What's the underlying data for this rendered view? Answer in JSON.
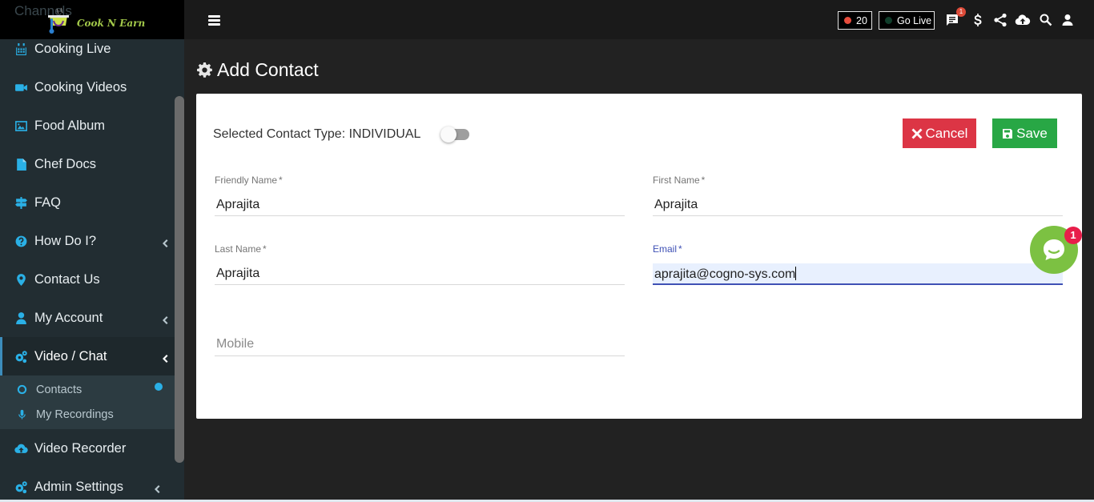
{
  "brand": {
    "ghost_label": "Channels",
    "name": "Cook N Earn"
  },
  "sidebar": {
    "items": [
      {
        "label": "Cooking Live"
      },
      {
        "label": "Cooking Videos"
      },
      {
        "label": "Food Album"
      },
      {
        "label": "Chef Docs"
      },
      {
        "label": "FAQ"
      },
      {
        "label": "How Do I?"
      },
      {
        "label": "Contact Us"
      },
      {
        "label": "My Account"
      },
      {
        "label": "Video / Chat"
      },
      {
        "label": "Video Recorder"
      },
      {
        "label": "Admin Settings"
      }
    ],
    "submenu": [
      {
        "label": "Contacts"
      },
      {
        "label": "My Recordings"
      }
    ]
  },
  "topbar": {
    "count": "20",
    "go_live": "Go Live",
    "notification_count": "1",
    "colors": {
      "count_dot": "#e74c3c",
      "live_dot": "#0f3d2a"
    }
  },
  "page": {
    "title": "Add Contact"
  },
  "form": {
    "contact_type": "Selected Contact Type: INDIVIDUAL",
    "cancel_label": "Cancel",
    "save_label": "Save",
    "required_mark": "*",
    "friendly_name": {
      "label": "Friendly Name",
      "value": "Aprajita"
    },
    "first_name": {
      "label": "First Name",
      "value": "Aprajita"
    },
    "last_name": {
      "label": "Last Name",
      "value": "Aprajita"
    },
    "email": {
      "label": "Email",
      "value": "aprajita@cogno-sys.com"
    },
    "mobile": {
      "placeholder": "Mobile"
    }
  },
  "chat": {
    "badge": "1"
  },
  "icons": {
    "hamburger": "menu-icon",
    "chat": "chat-icon",
    "dollar": "dollar-icon",
    "share": "share-icon",
    "upload": "cloud-upload-icon",
    "search": "search-icon",
    "user": "user-icon"
  }
}
